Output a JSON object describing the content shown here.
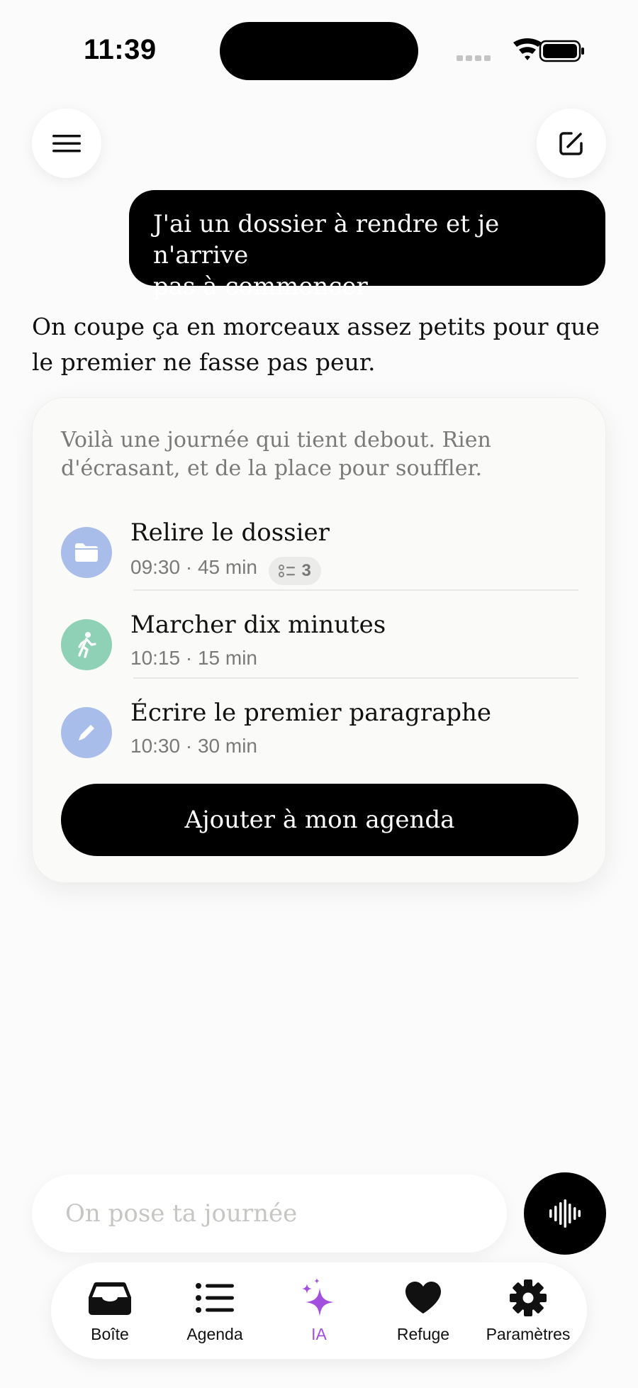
{
  "status_bar": {
    "time": "11:39"
  },
  "header": {
    "menu_icon": "hamburger-menu-icon",
    "new_icon": "compose-icon"
  },
  "conversation": {
    "user_message_line1": "J'ai un dossier à rendre et je n'arrive",
    "user_message_line2": "pas à commencer",
    "assistant_message": "On coupe ça en morceaux assez petits pour que le premier ne fasse pas peur."
  },
  "plan_card": {
    "intro": "Voilà une journée qui tient debout. Rien d'écrasant, et de la place pour souffler.",
    "tasks": [
      {
        "title": "Relire le dossier",
        "meta": "09:30 · 45 min",
        "subtasks": "3",
        "icon": "folder-icon",
        "color": "#a9bdea"
      },
      {
        "title": "Marcher dix minutes",
        "meta": "10:15 · 15 min",
        "icon": "walking-person-icon",
        "color": "#8fd1b6"
      },
      {
        "title": "Écrire le premier paragraphe",
        "meta": "10:30 · 30 min",
        "icon": "pencil-icon",
        "color": "#a9bdea"
      }
    ],
    "cta_label": "Ajouter à mon agenda"
  },
  "composer": {
    "placeholder": "On pose ta journée",
    "voice_icon": "waveform-icon"
  },
  "tabbar": {
    "tabs": [
      {
        "label": "Boîte",
        "icon": "inbox-tray-icon"
      },
      {
        "label": "Agenda",
        "icon": "list-icon"
      },
      {
        "label": "IA",
        "icon": "sparkles-icon",
        "active": true
      },
      {
        "label": "Refuge",
        "icon": "heart-icon"
      },
      {
        "label": "Paramètres",
        "icon": "gear-icon"
      }
    ],
    "active_color": "#a24fe0"
  }
}
